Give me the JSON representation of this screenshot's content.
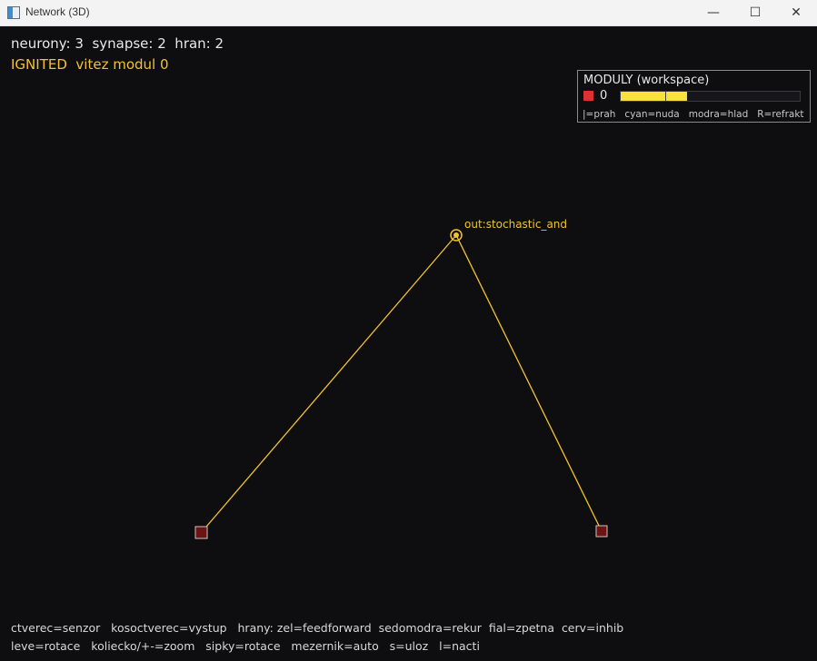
{
  "window": {
    "title": "Network (3D)",
    "buttons": {
      "minimize": "—",
      "maximize": "☐",
      "close": "✕"
    }
  },
  "hud": {
    "stats": "neurony: 3  synapse: 2  hran: 2",
    "status": "IGNITED  vitez modul 0",
    "status_color": "#f2c230"
  },
  "modules_panel": {
    "title": "MODULY (workspace)",
    "modules": [
      {
        "id": "0",
        "color": "#e03030",
        "activation": 0.37,
        "threshold": 0.25,
        "bar_color": "#f7e040"
      }
    ],
    "legend": "|=prah   cyan=nuda   modra=hlad   R=refrakt"
  },
  "graph": {
    "edge_color": "#f2c230",
    "nodes": [
      {
        "id": "output",
        "shape": "circle",
        "label": "out:stochastic_and",
        "color": "#f2c230"
      },
      {
        "id": "sensor-1",
        "shape": "square",
        "label": "",
        "color": "#6a1414"
      },
      {
        "id": "sensor-2",
        "shape": "square",
        "label": "",
        "color": "#6a1414"
      }
    ],
    "edges": [
      {
        "from": "sensor-1",
        "to": "output"
      },
      {
        "from": "sensor-2",
        "to": "output"
      }
    ]
  },
  "help": {
    "line1": "ctverec=senzor   kosoctverec=vystup   hrany: zel=feedforward  sedomodra=rekur  fial=zpetna  cerv=inhib",
    "line2": "leve=rotace   koliecko/+-=zoom   sipky=rotace   mezernik=auto   s=uloz   l=nacti"
  }
}
